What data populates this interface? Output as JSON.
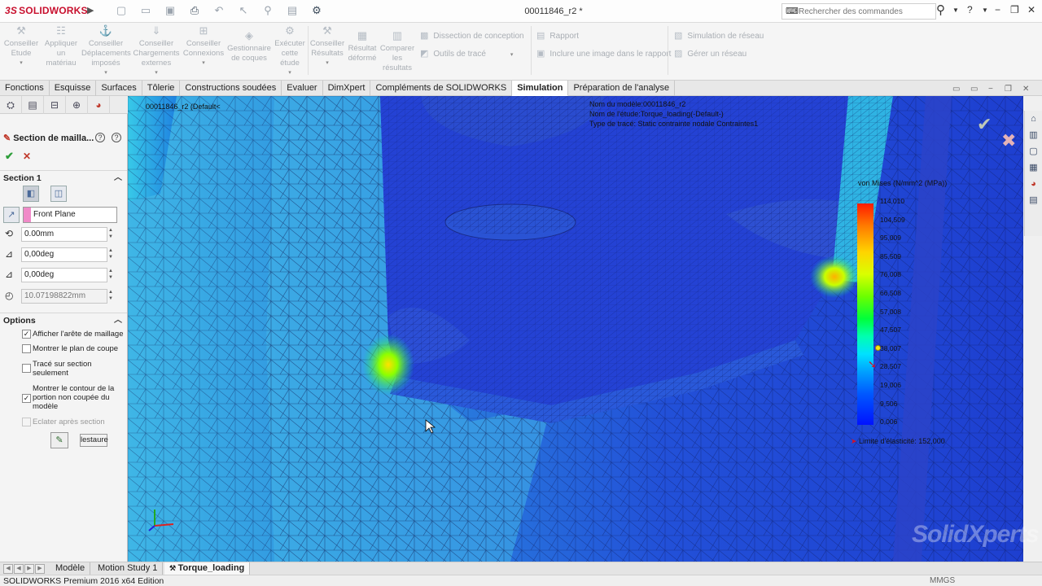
{
  "app": {
    "logo_prefix": "3S",
    "logo_text": "SOLIDWORKS",
    "doc_title": "00011846_r2 *",
    "search_placeholder": "Rechercher des commandes"
  },
  "command_manager": {
    "buttons": [
      {
        "label": "Conseiller Etude"
      },
      {
        "label": "Appliquer un matériau"
      },
      {
        "label": "Conseiller Déplacements imposés"
      },
      {
        "label": "Conseiller Chargements externes"
      },
      {
        "label": "Conseiller Connexions"
      },
      {
        "label": "Gestionnaire de coques"
      },
      {
        "label": "Exécuter cette étude"
      },
      {
        "label": "Conseiller Résultats"
      },
      {
        "label": "Résultat déformé"
      },
      {
        "label": "Comparer les résultats"
      }
    ],
    "side_items": [
      {
        "label": "Dissection de conception"
      },
      {
        "label": "Outils de tracé"
      },
      {
        "label": "Rapport"
      },
      {
        "label": "Inclure une image dans le rapport"
      },
      {
        "label": "Simulation de réseau"
      },
      {
        "label": "Gérer un réseau"
      }
    ]
  },
  "tabs": [
    {
      "label": "Fonctions"
    },
    {
      "label": "Esquisse"
    },
    {
      "label": "Surfaces"
    },
    {
      "label": "Tôlerie"
    },
    {
      "label": "Constructions soudées"
    },
    {
      "label": "Evaluer"
    },
    {
      "label": "DimXpert"
    },
    {
      "label": "Compléments de SOLIDWORKS"
    },
    {
      "label": "Simulation",
      "active": true
    },
    {
      "label": "Préparation de l'analyse"
    }
  ],
  "property_manager": {
    "title": "Section de mailla...",
    "section_group": "Section 1",
    "plane_ref": "Front Plane",
    "offset": "0.00mm",
    "angle1": "0,00deg",
    "angle2": "0,00deg",
    "radius": "10.07198822mm",
    "options_group": "Options",
    "options": [
      {
        "label": "Afficher l'arête de maillage",
        "checked": true,
        "disabled": false
      },
      {
        "label": "Montrer le plan de coupe",
        "checked": false,
        "disabled": false
      },
      {
        "label": "Tracé sur section seulement",
        "checked": false,
        "disabled": false
      },
      {
        "label": "Montrer le contour de la portion non coupée du modèle",
        "checked": true,
        "disabled": false
      },
      {
        "label": "Eclater après section",
        "checked": false,
        "disabled": true
      }
    ],
    "restore_label": "lestaure"
  },
  "viewport": {
    "tree_label": "00011846_r2  (Default<",
    "info_lines": [
      "Nom du modèle:00011846_r2",
      "Nom de l'étude:Torque_loading(-Default-)",
      "Type de tracé: Static contrainte nodale Contraintes1"
    ],
    "legend_title": "von Mises (N/mm^2 (MPa))",
    "legend_values": [
      "114,010",
      "104,509",
      "95,009",
      "85,509",
      "76,008",
      "66,508",
      "57,008",
      "47,507",
      "38,007",
      "28,507",
      "19,006",
      "9,506",
      "0,006"
    ],
    "yield_label": "Limite d'élasticité: 152,000",
    "yield_value": 152.0,
    "marker_value": 38.0
  },
  "bottom_tabs": [
    {
      "label": "Modèle"
    },
    {
      "label": "Motion Study 1"
    },
    {
      "label": "Torque_loading",
      "active": true
    }
  ],
  "status": {
    "edition": "SOLIDWORKS Premium 2016 x64 Edition",
    "units": "MMGS"
  },
  "watermark": "SolidXperts",
  "colors": {
    "brand_red": "#c8102e",
    "mesh_blue": "#1f3fd6",
    "ok_green": "#2e9e3a"
  }
}
